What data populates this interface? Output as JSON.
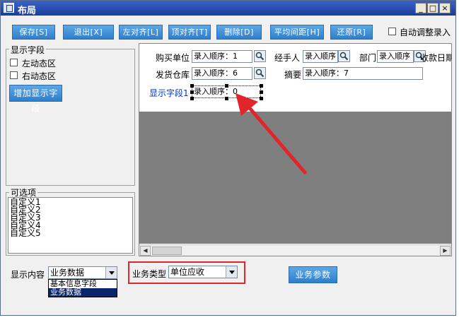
{
  "window": {
    "title": "布局",
    "controls": {
      "minimize": "_",
      "maximize": "□",
      "close": "×"
    }
  },
  "toolbar": {
    "save": "保存[S]",
    "exit": "退出[X]",
    "align_left": "左对齐[L]",
    "align_top": "顶对齐[T]",
    "delete": "删除[D]",
    "even_spacing": "平均间距[H]",
    "restore": "还原[R]",
    "auto_adjust_label": "自动调整录入"
  },
  "display_fields": {
    "title": "显示字段",
    "left_dynamic": "左动态区",
    "right_dynamic": "右动态区",
    "add_button": "增加显示字段"
  },
  "options": {
    "title": "可选项",
    "items": [
      "自定义1",
      "自定义2",
      "自定义3",
      "自定义4",
      "自定义5"
    ]
  },
  "designer": {
    "buyer_label": "购买单位",
    "buyer_value": "录入顺序：1",
    "handler_label": "经手人",
    "handler_value": "录入顺序",
    "dept_label": "部门",
    "dept_value": "录入顺序",
    "receipt_date_label": "收款日期",
    "warehouse_label": "发货仓库",
    "warehouse_value": "录入顺序：6",
    "summary_label": "摘要",
    "summary_value": "录入顺序：7",
    "display_field_label": "显示字段1",
    "display_field_value": "录入顺序：0"
  },
  "bottom": {
    "content_label": "显示内容",
    "content_value": "业务数据",
    "content_options": [
      "基本信息字段",
      "业务数据"
    ],
    "type_label": "业务类型",
    "type_value": "单位应收",
    "params_button": "业务参数"
  },
  "colors": {
    "accent_button": "#2f7ecb",
    "highlight_red": "#e0262b",
    "canvas_gray": "#7f7f7f",
    "selection": "#0a246a",
    "blue_label": "#0033cc"
  }
}
